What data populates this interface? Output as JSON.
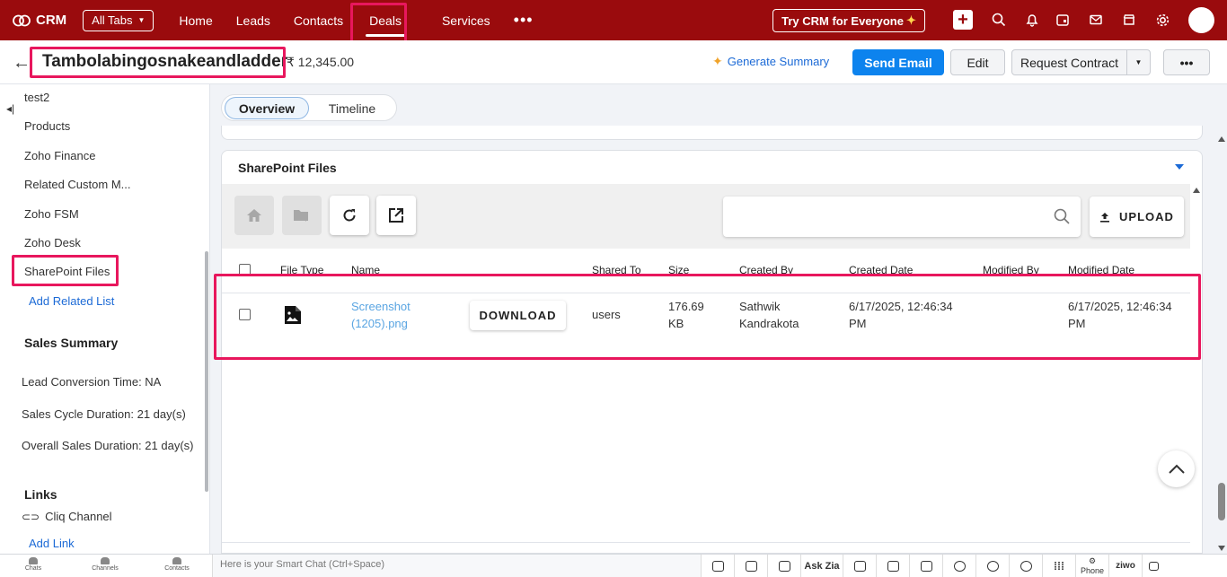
{
  "topbar": {
    "app_name": "CRM",
    "all_tabs_label": "All Tabs",
    "nav": [
      "Home",
      "Leads",
      "Contacts",
      "Deals",
      "Services"
    ],
    "active_nav": "Deals",
    "more_label": "•••",
    "try_crm_label": "Try CRM for Everyone",
    "icons": [
      "plus-icon",
      "search-icon",
      "bell-icon",
      "calendar-icon",
      "mail-icon",
      "store-icon",
      "gear-icon",
      "avatar"
    ]
  },
  "record": {
    "title": "Tambolabingosnakeandladder",
    "amount": "₹ 12,345.00",
    "generate_summary": "Generate Summary",
    "send_email": "Send Email",
    "edit": "Edit",
    "request_contract": "Request Contract",
    "more": "•••"
  },
  "sidebar": {
    "items": [
      "test2",
      "Products",
      "Zoho Finance",
      "Related Custom M...",
      "Zoho FSM",
      "Zoho Desk",
      "SharePoint Files"
    ],
    "add_related_list": "Add Related List",
    "sales_summary_title": "Sales Summary",
    "stats": [
      "Lead Conversion Time: NA",
      "Sales Cycle Duration: 21 day(s)",
      "Overall Sales Duration: 21 day(s)"
    ],
    "links_title": "Links",
    "cliq_channel": "Cliq Channel",
    "add_link": "Add Link"
  },
  "tabs": {
    "overview": "Overview",
    "timeline": "Timeline"
  },
  "sharepoint": {
    "title": "SharePoint Files",
    "search_placeholder": "",
    "upload_label": "UPLOAD",
    "columns": [
      "File Type",
      "Name",
      "Shared To",
      "Size",
      "Created By",
      "Created Date",
      "Modified By",
      "Modified Date"
    ],
    "rows": [
      {
        "name_line1": "Screenshot",
        "name_line2": "(1205).png",
        "download_label": "DOWNLOAD",
        "shared_to": "users",
        "size_line1": "176.69",
        "size_line2": "KB",
        "created_by_line1": "Sathwik",
        "created_by_line2": "Kandrakota",
        "created_date_line1": "6/17/2025, 12:46:34",
        "created_date_line2": "PM",
        "modified_by": "",
        "modified_date_line1": "6/17/2025, 12:46:34",
        "modified_date_line2": "PM"
      }
    ]
  },
  "bottombar": {
    "tabs": [
      "Chats",
      "Channels",
      "Contacts"
    ],
    "smart_chat_placeholder": "Here is your Smart Chat (Ctrl+Space)",
    "ask_zia": "Ask Zia",
    "phone": "Phone",
    "brand": "ziwo"
  },
  "colors": {
    "topbar": "#9a0b0d",
    "primary": "#0d83ee",
    "link": "#1c6ad6",
    "highlight": "#e8175d"
  }
}
